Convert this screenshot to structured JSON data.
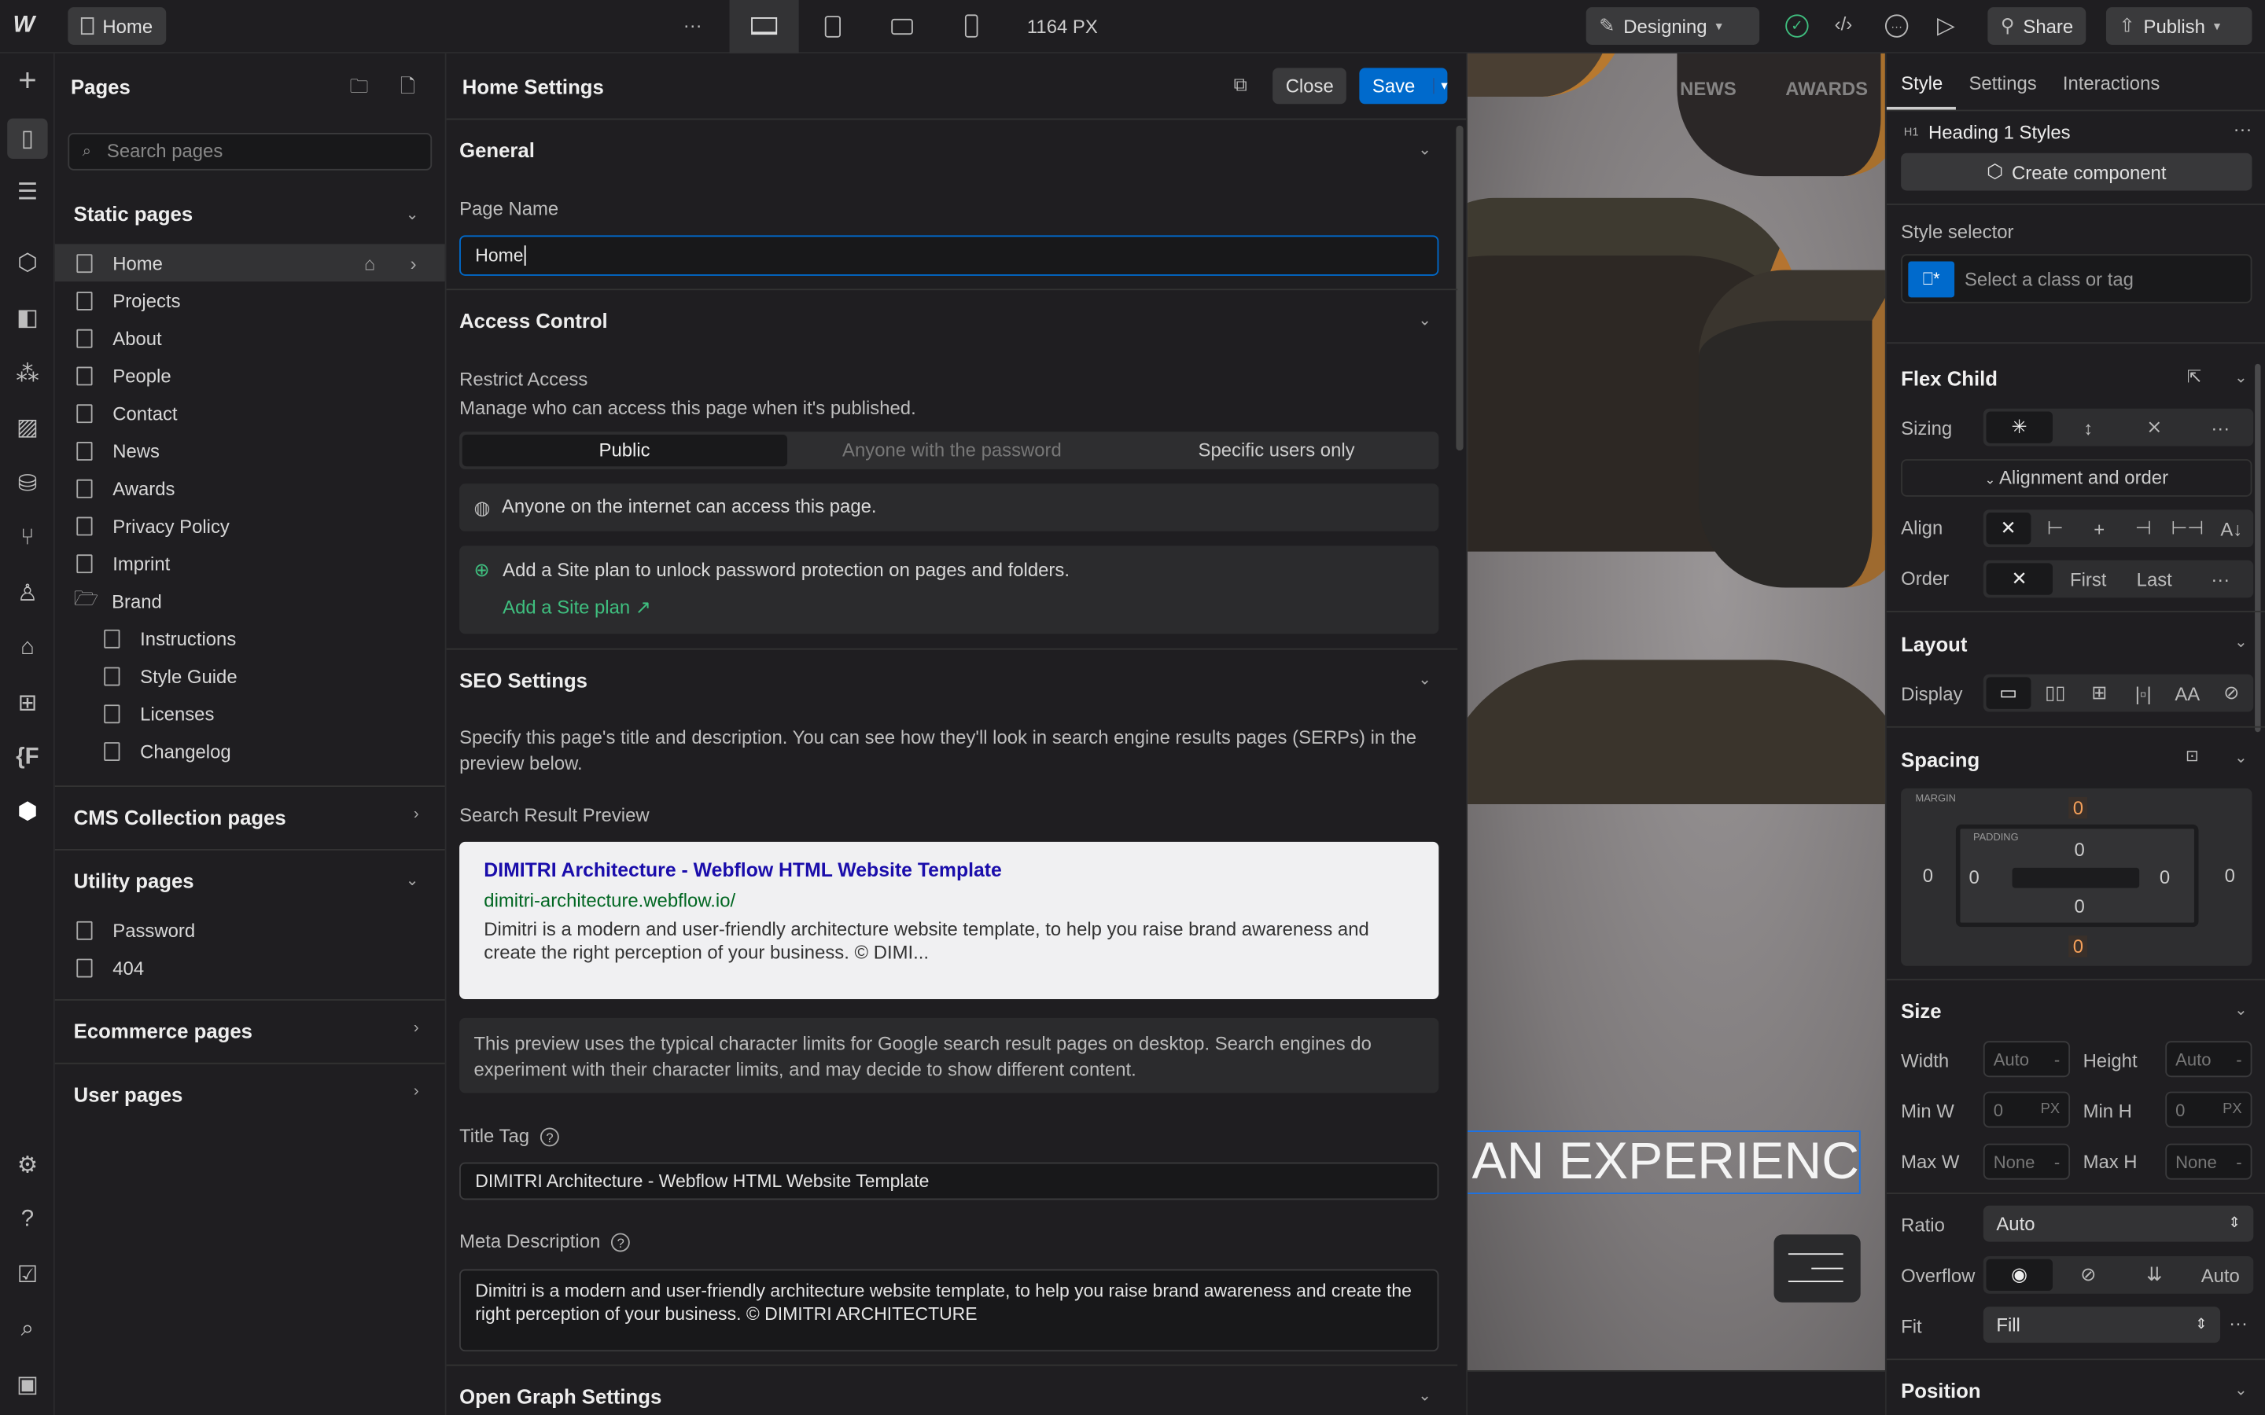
{
  "topbar": {
    "page_tab": "Home",
    "more": "···",
    "width": "1164 PX",
    "mode": "Designing",
    "share": "Share",
    "publish": "Publish"
  },
  "pages": {
    "title": "Pages",
    "search_placeholder": "Search pages",
    "static_title": "Static pages",
    "static": [
      "Home",
      "Projects",
      "About",
      "People",
      "Contact",
      "News",
      "Awards",
      "Privacy Policy",
      "Imprint",
      "Brand"
    ],
    "brand_children": [
      "Instructions",
      "Style Guide",
      "Licenses",
      "Changelog"
    ],
    "cms_title": "CMS Collection pages",
    "utility_title": "Utility pages",
    "utility": [
      "Password",
      "404"
    ],
    "ecommerce_title": "Ecommerce pages",
    "user_title": "User pages"
  },
  "settings": {
    "title": "Home Settings",
    "close": "Close",
    "save": "Save",
    "general": {
      "title": "General",
      "page_name_label": "Page Name",
      "page_name": "Home"
    },
    "access": {
      "title": "Access Control",
      "restrict_label": "Restrict Access",
      "restrict_desc": "Manage who can access this page when it's published.",
      "options": [
        "Public",
        "Anyone with the password",
        "Specific users only"
      ],
      "public_note": "Anyone on the internet can access this page.",
      "plan_note": "Add a Site plan to unlock password protection on pages and folders.",
      "plan_link": "Add a Site plan ↗"
    },
    "seo": {
      "title": "SEO Settings",
      "desc": "Specify this page's title and description. You can see how they'll look in search engine results pages (SERPs) in the preview below.",
      "preview_label": "Search Result Preview",
      "preview_title": "DIMITRI Architecture - Webflow HTML Website Template",
      "preview_url": "dimitri-architecture.webflow.io/",
      "preview_desc": "Dimitri is a modern and user-friendly architecture website template, to help you raise brand awareness and create the right perception of your business. © DIMI...",
      "preview_note": "This preview uses the typical character limits for Google search result pages on desktop. Search engines do experiment with their character limits, and may decide to show different content.",
      "title_tag_label": "Title Tag",
      "title_tag": "DIMITRI Architecture - Webflow HTML Website Template",
      "meta_label": "Meta Description",
      "meta": "Dimitri is a modern and user-friendly architecture website template, to help you raise brand awareness and create the right perception of your business. © DIMITRI ARCHITECTURE"
    },
    "og_title": "Open Graph Settings"
  },
  "canvas": {
    "nav": [
      "NEWS",
      "AWARDS"
    ],
    "heading": "IAN EXPERIENCE"
  },
  "style": {
    "tabs": [
      "Style",
      "Settings",
      "Interactions"
    ],
    "tag": "H1",
    "element": "Heading 1 Styles",
    "create_component": "Create component",
    "selector_label": "Style selector",
    "selector_placeholder": "Select a class or tag",
    "flex_child": {
      "title": "Flex Child",
      "sizing": "Sizing",
      "alignment": "Alignment and order",
      "align": "Align",
      "order": "Order",
      "order_opts": [
        "First",
        "Last"
      ]
    },
    "layout": {
      "title": "Layout",
      "display": "Display"
    },
    "spacing": {
      "title": "Spacing",
      "margin_label": "MARGIN",
      "padding_label": "PADDING",
      "margin": {
        "top": "0",
        "right": "0",
        "bottom": "0",
        "left": "0"
      },
      "padding": {
        "top": "0",
        "right": "0",
        "bottom": "0",
        "left": "0"
      }
    },
    "size": {
      "title": "Size",
      "width_label": "Width",
      "width": "Auto",
      "height_label": "Height",
      "height": "Auto",
      "minw_label": "Min W",
      "minw": "0",
      "minh_label": "Min H",
      "minh": "0",
      "maxw_label": "Max W",
      "maxw": "None",
      "maxh_label": "Max H",
      "maxh": "None",
      "unit": "PX",
      "dash": "-",
      "ratio_label": "Ratio",
      "ratio": "Auto",
      "overflow_label": "Overflow",
      "overflow_auto": "Auto",
      "fit_label": "Fit",
      "fit": "Fill"
    },
    "position_title": "Position"
  },
  "colors": {
    "accent": "#006acc",
    "link": "#1a0dab",
    "url": "#006621",
    "margin_hl": "#f5a05a",
    "green": "#3fbf7f"
  }
}
